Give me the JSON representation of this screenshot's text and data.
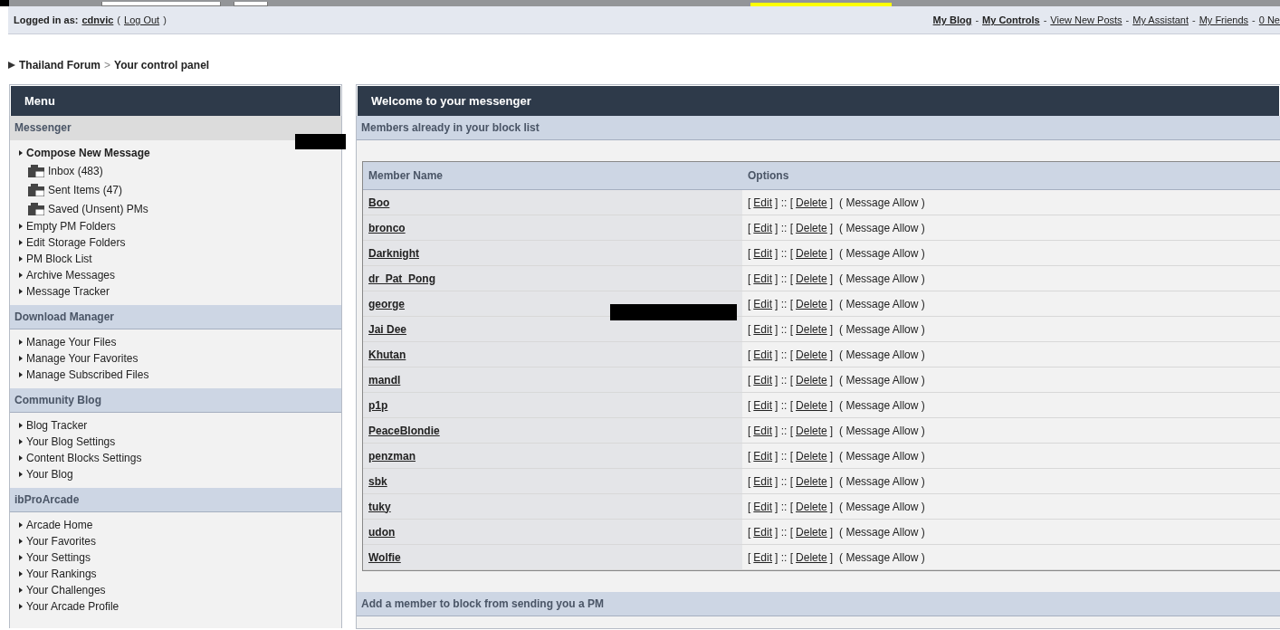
{
  "top_bar": {
    "user": {
      "label": "Logged in as:",
      "name": "cdnvic",
      "open": "(",
      "logout": "Log Out",
      "close": ")"
    },
    "links": [
      {
        "label": "My Blog",
        "bold": true
      },
      {
        "label": "My Controls",
        "bold": true
      },
      {
        "label": "View New Posts",
        "bold": false
      },
      {
        "label": "My Assistant",
        "bold": false
      },
      {
        "label": "My Friends",
        "bold": false
      },
      {
        "label": "0 Ne",
        "bold": false
      }
    ],
    "separator": "-"
  },
  "breadcrumb": {
    "items": [
      "Thailand Forum",
      "Your control panel"
    ],
    "separator": ">"
  },
  "sidebar": {
    "title": "Menu",
    "sections": [
      {
        "title": "Messenger",
        "selected": true,
        "items": [
          {
            "label": "Compose New Message",
            "kind": "link",
            "bold": true
          },
          {
            "label": "Inbox (483)",
            "kind": "folder",
            "bold": false
          },
          {
            "label": "Sent Items (47)",
            "kind": "folder",
            "bold": false
          },
          {
            "label": "Saved (Unsent) PMs",
            "kind": "folder",
            "bold": false
          },
          {
            "label": "Empty PM Folders",
            "kind": "link",
            "bold": false
          },
          {
            "label": "Edit Storage Folders",
            "kind": "link",
            "bold": false
          },
          {
            "label": "PM Block List",
            "kind": "link",
            "bold": false
          },
          {
            "label": "Archive Messages",
            "kind": "link",
            "bold": false
          },
          {
            "label": "Message Tracker",
            "kind": "link",
            "bold": false
          }
        ]
      },
      {
        "title": "Download Manager",
        "selected": false,
        "items": [
          {
            "label": "Manage Your Files",
            "kind": "link",
            "bold": false
          },
          {
            "label": "Manage Your Favorites",
            "kind": "link",
            "bold": false
          },
          {
            "label": "Manage Subscribed Files",
            "kind": "link",
            "bold": false
          }
        ]
      },
      {
        "title": "Community Blog",
        "selected": false,
        "items": [
          {
            "label": "Blog Tracker",
            "kind": "link",
            "bold": false
          },
          {
            "label": "Your Blog Settings",
            "kind": "link",
            "bold": false
          },
          {
            "label": "Content Blocks Settings",
            "kind": "link",
            "bold": false
          },
          {
            "label": "Your Blog",
            "kind": "link",
            "bold": false
          }
        ]
      },
      {
        "title": "ibProArcade",
        "selected": false,
        "items": [
          {
            "label": "Arcade Home",
            "kind": "link",
            "bold": false
          },
          {
            "label": "Your Favorites",
            "kind": "link",
            "bold": false
          },
          {
            "label": "Your Settings",
            "kind": "link",
            "bold": false
          },
          {
            "label": "Your Rankings",
            "kind": "link",
            "bold": false
          },
          {
            "label": "Your Challenges",
            "kind": "link",
            "bold": false
          },
          {
            "label": "Your Arcade Profile",
            "kind": "link",
            "bold": false
          }
        ]
      }
    ]
  },
  "main": {
    "title": "Welcome to your messenger",
    "block_list": {
      "title": "Members already in your block list",
      "columns": [
        "Member Name",
        "Options"
      ],
      "rows": [
        {
          "name": "Boo",
          "options": [
            "[",
            "Edit",
            "] :: [",
            "Delete",
            "]",
            "( Message Allow )"
          ]
        },
        {
          "name": "bronco",
          "options": [
            "[",
            "Edit",
            "] :: [",
            "Delete",
            "]",
            "( Message Allow )"
          ]
        },
        {
          "name": "Darknight",
          "options": [
            "[",
            "Edit",
            "] :: [",
            "Delete",
            "]",
            "( Message Allow )"
          ]
        },
        {
          "name": "dr_Pat_Pong",
          "options": [
            "[",
            "Edit",
            "] :: [",
            "Delete",
            "]",
            "( Message Allow )"
          ]
        },
        {
          "name": "george",
          "options": [
            "[",
            "Edit",
            "] :: [",
            "Delete",
            "]",
            "( Message Allow )"
          ]
        },
        {
          "name": "Jai Dee",
          "options": [
            "[",
            "Edit",
            "] :: [",
            "Delete",
            "]",
            "( Message Allow )"
          ]
        },
        {
          "name": "Khutan",
          "options": [
            "[",
            "Edit",
            "] :: [",
            "Delete",
            "]",
            "( Message Allow )"
          ]
        },
        {
          "name": "mandl",
          "options": [
            "[",
            "Edit",
            "] :: [",
            "Delete",
            "]",
            "( Message Allow )"
          ]
        },
        {
          "name": "p1p",
          "options": [
            "[",
            "Edit",
            "] :: [",
            "Delete",
            "]",
            "( Message Allow )"
          ]
        },
        {
          "name": "PeaceBlondie",
          "options": [
            "[",
            "Edit",
            "] :: [",
            "Delete",
            "]",
            "( Message Allow )"
          ]
        },
        {
          "name": "penzman",
          "options": [
            "[",
            "Edit",
            "] :: [",
            "Delete",
            "]",
            "( Message Allow )"
          ]
        },
        {
          "name": "sbk",
          "options": [
            "[",
            "Edit",
            "] :: [",
            "Delete",
            "]",
            "( Message Allow )"
          ]
        },
        {
          "name": "tuky",
          "options": [
            "[",
            "Edit",
            "] :: [",
            "Delete",
            "]",
            "( Message Allow )"
          ]
        },
        {
          "name": "udon",
          "options": [
            "[",
            "Edit",
            "] :: [",
            "Delete",
            "]",
            "( Message Allow )"
          ]
        },
        {
          "name": "Wolfie",
          "options": [
            "[",
            "Edit",
            "] :: [",
            "Delete",
            "]",
            "( Message Allow )"
          ]
        }
      ]
    },
    "add_section": {
      "title": "Add a member to block from sending you a PM"
    }
  }
}
